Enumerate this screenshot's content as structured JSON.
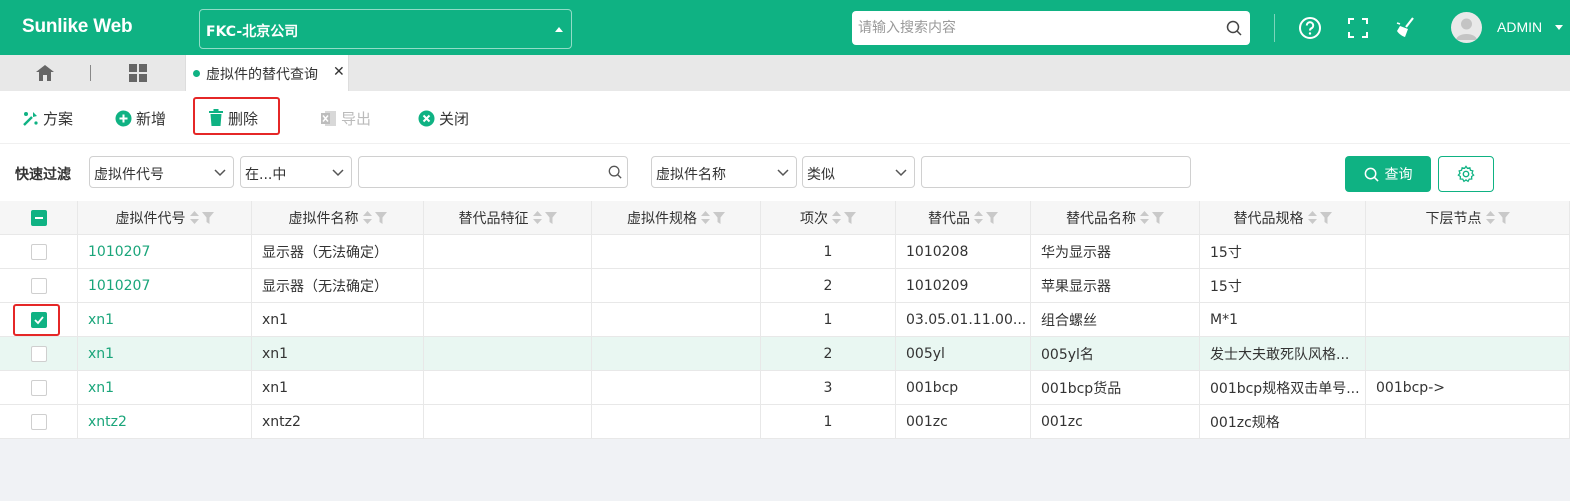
{
  "app": {
    "brand": "Sunlike Web",
    "company": "FKC-北京公司",
    "search_placeholder": "请输入搜索内容",
    "username": "ADMIN"
  },
  "tabs": {
    "active_label": "虚拟件的替代查询",
    "close_glyph": "✕"
  },
  "toolbar": {
    "scheme": "方案",
    "add": "新增",
    "delete": "删除",
    "export": "导出",
    "close": "关闭"
  },
  "filter": {
    "label": "快速过滤",
    "field1": "虚拟件代号",
    "op1": "在...中",
    "value1": "",
    "field2": "虚拟件名称",
    "op2": "类似",
    "value2": "",
    "query": "查询"
  },
  "table": {
    "columns": [
      "虚拟件代号",
      "虚拟件名称",
      "替代品特征",
      "虚拟件规格",
      "项次",
      "替代品",
      "替代品名称",
      "替代品规格",
      "下层节点"
    ],
    "rows": [
      {
        "code": "1010207",
        "name": "显示器（无法确定）",
        "feature": "",
        "spec": "",
        "seq": "1",
        "sub": "1010208",
        "sub_name": "华为显示器",
        "sub_spec": "15寸",
        "node": "",
        "checked": false
      },
      {
        "code": "1010207",
        "name": "显示器（无法确定）",
        "feature": "",
        "spec": "",
        "seq": "2",
        "sub": "1010209",
        "sub_name": "苹果显示器",
        "sub_spec": "15寸",
        "node": "",
        "checked": false
      },
      {
        "code": "xn1",
        "name": "xn1",
        "feature": "",
        "spec": "",
        "seq": "1",
        "sub": "03.05.01.11.00...",
        "sub_name": "组合螺丝",
        "sub_spec": "M*1",
        "node": "",
        "checked": true
      },
      {
        "code": "xn1",
        "name": "xn1",
        "feature": "",
        "spec": "",
        "seq": "2",
        "sub": "005yl",
        "sub_name": "005yl名",
        "sub_spec": "发士大夫敢死队风格...",
        "node": "",
        "checked": false
      },
      {
        "code": "xn1",
        "name": "xn1",
        "feature": "",
        "spec": "",
        "seq": "3",
        "sub": "001bcp",
        "sub_name": "001bcp货品",
        "sub_spec": "001bcp规格双击单号...",
        "node": "001bcp->",
        "checked": false
      },
      {
        "code": "xntz2",
        "name": "xntz2",
        "feature": "",
        "spec": "",
        "seq": "1",
        "sub": "001zc",
        "sub_name": "001zc",
        "sub_spec": "001zc规格",
        "node": "",
        "checked": false
      }
    ]
  },
  "colors": {
    "primary": "#0fb283",
    "link": "#1aa57a",
    "highlight_box": "#e52727",
    "row_hover": "#e9f7f2"
  },
  "icons": [
    "search-icon",
    "help-icon",
    "fullscreen-icon",
    "broom-icon",
    "avatar-icon",
    "home-icon",
    "grid-icon",
    "scheme-icon",
    "add-icon",
    "trash-icon",
    "excel-icon",
    "close-circle-icon",
    "chevron-down-icon",
    "gear-icon",
    "sort-icon",
    "filter-icon"
  ]
}
